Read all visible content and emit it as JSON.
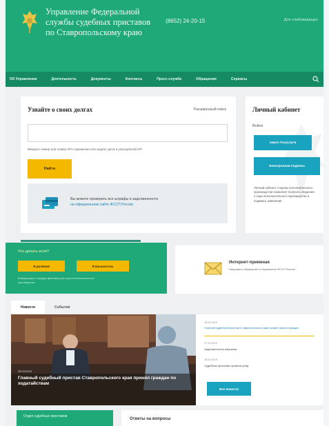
{
  "header": {
    "org_line1": "Управление Федеральной",
    "org_line2": "службы судебных приставов",
    "org_line3": "по Ставропольскому краю",
    "phone": "(8652) 24-20-15",
    "top_link": "Для слабовидящих"
  },
  "nav": {
    "items": [
      "Об Управлении",
      "Деятельность",
      "Документы",
      "Контакты",
      "Пресс-служба",
      "Обращения",
      "Сервисы"
    ]
  },
  "debt": {
    "title": "Узнайте о своих долгах",
    "advanced_link": "Расширенный поиск",
    "input_placeholder": "",
    "hint": "Введите номер или номер ИП и фамилию или индекс дела в упрощённой ИП",
    "find_button": "Найти",
    "info_line1": "Вы можете проверить все штрафы и задолженности",
    "info_line2": "на официальном сайте ФССП России"
  },
  "cabinet": {
    "title": "Личный кабинет",
    "login_label": "Войти",
    "gosuslugi_button": "через Госуслуги",
    "signature_button": "Электронная подпись",
    "description": "Личный кабинет стороны исполнительного производства позволяет получать сведения о ходе исполнительного производства и подавать заявления"
  },
  "promo": {
    "title": "Что делать если?",
    "button1": "Я должник",
    "button2": "Я взыскатель",
    "note": "Информация о порядке действий для сторон исполнительного производства"
  },
  "reception": {
    "title": "Интернет-приемная",
    "description": "Направить обращение в Управление ФССП России"
  },
  "tabs": {
    "news": "Новости",
    "events": "События"
  },
  "news": {
    "main_date": "28.03.2019",
    "main_caption": "Главный судебный пристав Ставропольского края принял граждан по ходатайствам",
    "items": [
      {
        "date": "28.03.2019",
        "text": "Главный судебный пристав Ставропольского края провел прием граждан"
      },
      {
        "date": "27.03.2019",
        "text": "Задолженность взыскана"
      },
      {
        "date": "26.03.2019",
        "text": "Судебные приставы провели рейд"
      }
    ],
    "all_button": "Все новости"
  },
  "bottom": {
    "green_text": "Отдел судебных приставов",
    "white_text": "Ответы на вопросы"
  },
  "colors": {
    "primary_green": "#1fa878",
    "nav_green": "#168a62",
    "accent_yellow": "#f5b800",
    "accent_blue": "#1aa3bf"
  }
}
